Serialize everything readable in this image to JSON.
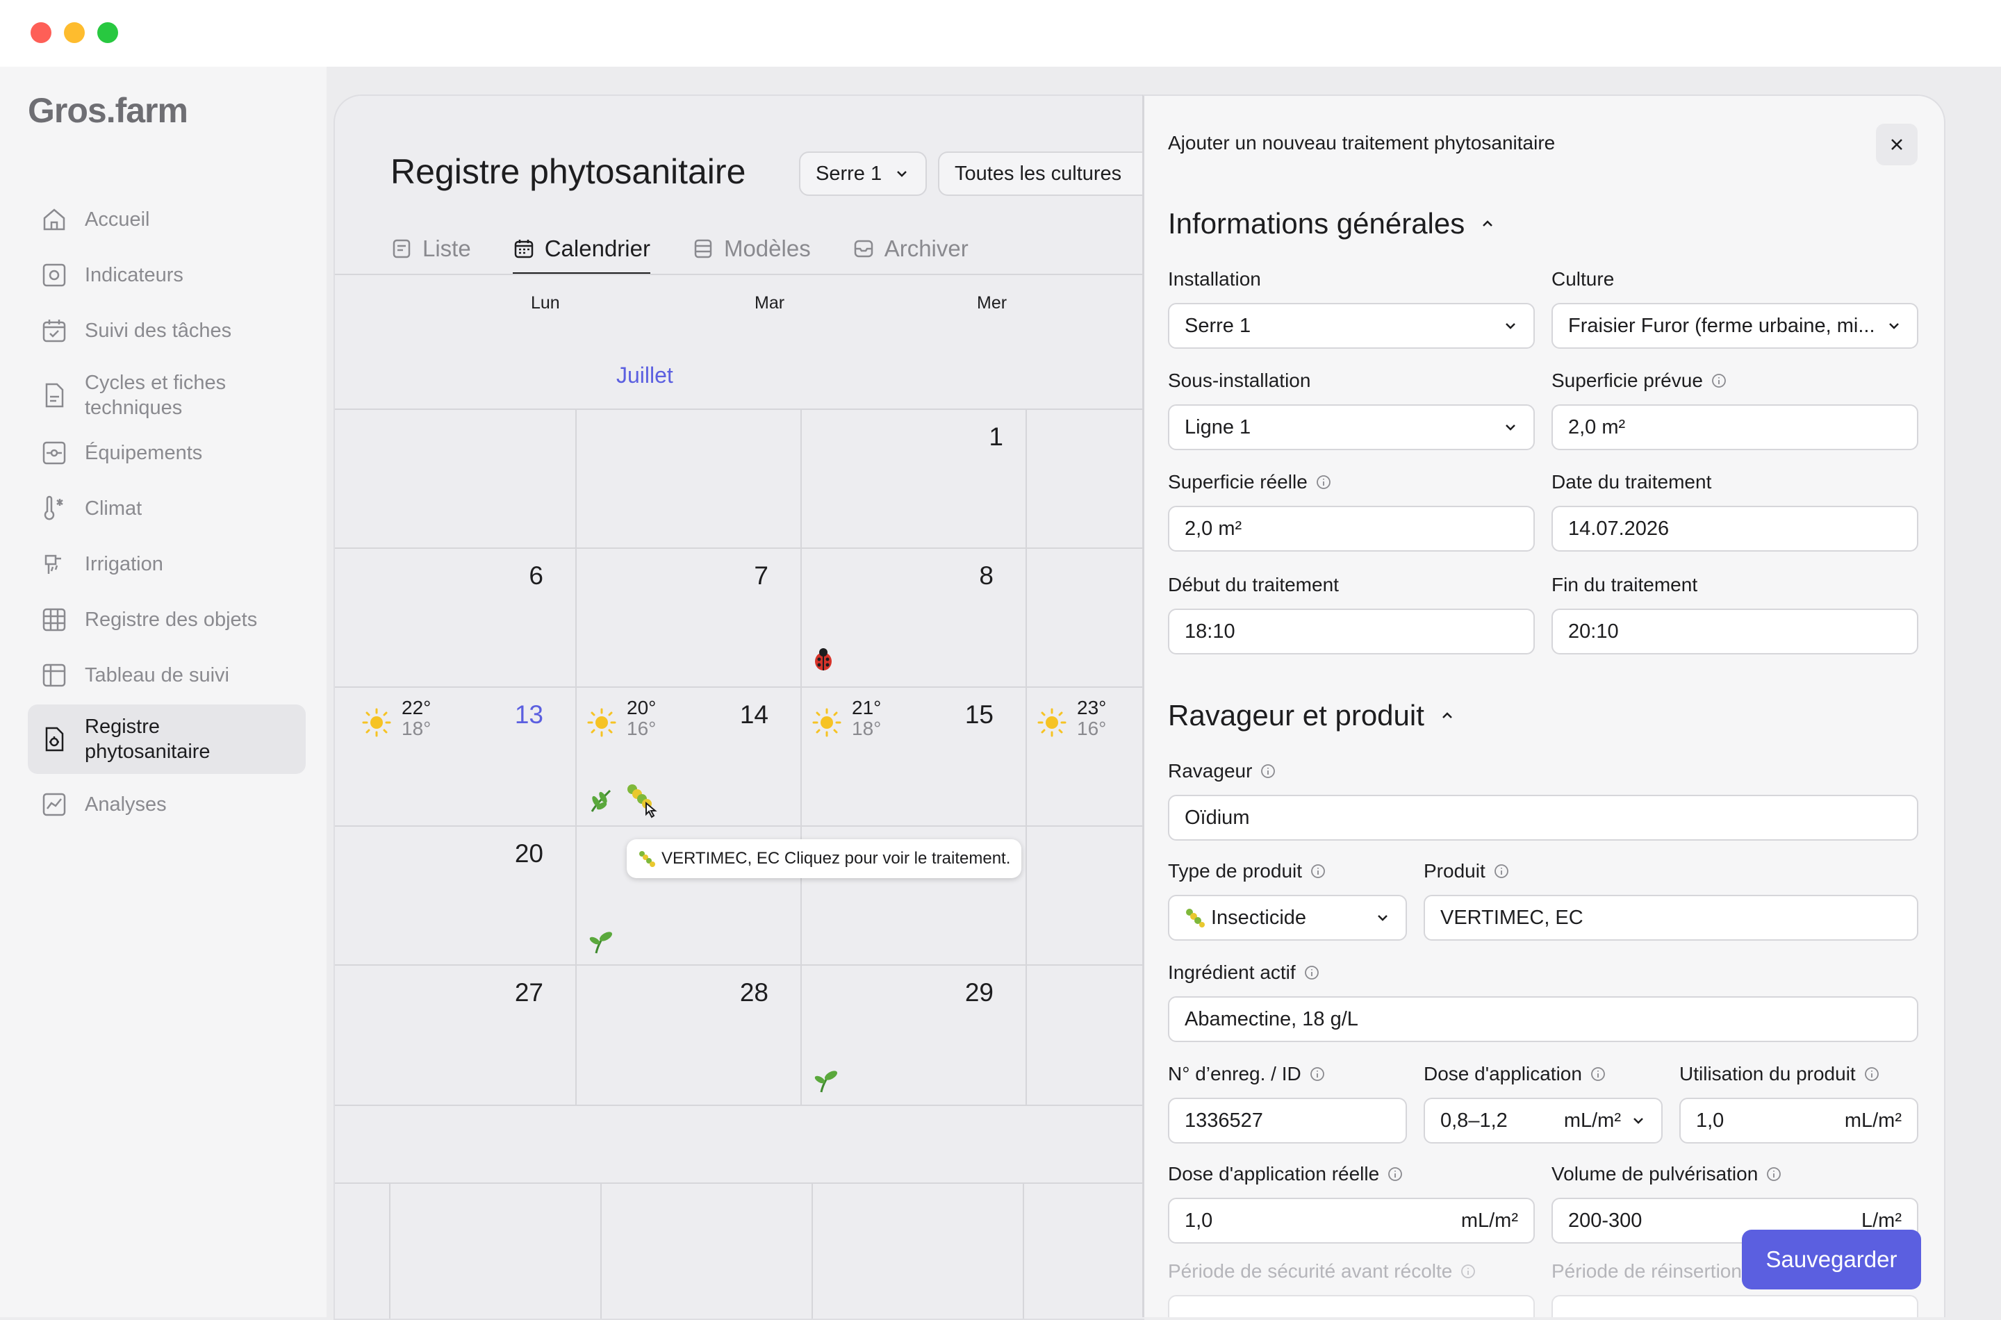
{
  "app": {
    "logo": "Gros.farm"
  },
  "sidebar": {
    "items": [
      {
        "label": "Accueil",
        "icon": "home-icon"
      },
      {
        "label": "Indicateurs",
        "icon": "indicators-icon"
      },
      {
        "label": "Suivi des tâches",
        "icon": "calendar-check-icon"
      },
      {
        "label": "Cycles et fiches techniques",
        "icon": "document-icon"
      },
      {
        "label": "Équipements",
        "icon": "equipment-icon"
      },
      {
        "label": "Climat",
        "icon": "thermometer-icon"
      },
      {
        "label": "Irrigation",
        "icon": "irrigation-icon"
      },
      {
        "label": "Registre des objets",
        "icon": "grid-icon"
      },
      {
        "label": "Tableau de suivi",
        "icon": "table-icon"
      },
      {
        "label": "Registre phytosanitaire",
        "icon": "phyto-register-icon",
        "active": true
      },
      {
        "label": "Analyses",
        "icon": "chart-icon"
      }
    ]
  },
  "main": {
    "title": "Registre phytosanitaire",
    "filters": {
      "installation": "Serre 1",
      "culture": "Toutes les cultures"
    },
    "tabs": [
      {
        "label": "Liste",
        "icon": "list-icon"
      },
      {
        "label": "Calendrier",
        "icon": "calendar-icon",
        "active": true
      },
      {
        "label": "Modèles",
        "icon": "templates-icon"
      },
      {
        "label": "Archiver",
        "icon": "archive-icon"
      }
    ],
    "calendar": {
      "day_headers": [
        "Lun",
        "Mar",
        "Mer"
      ],
      "month": "Juillet",
      "days": {
        "d1": "1",
        "d6": "6",
        "d7": "7",
        "d8": "8",
        "d13": "13",
        "d14": "14",
        "d15": "15",
        "d20": "20",
        "d27": "27",
        "d28": "28",
        "d29": "29"
      },
      "weather": [
        {
          "hi": "22°",
          "lo": "18°"
        },
        {
          "hi": "20°",
          "lo": "16°"
        },
        {
          "hi": "21°",
          "lo": "18°"
        },
        {
          "hi": "23°",
          "lo": "16°"
        }
      ],
      "tooltip": "VERTIMEC, EC Cliquez pour voir le traitement."
    }
  },
  "panel": {
    "title": "Ajouter un nouveau traitement phytosanitaire",
    "sections": {
      "general": "Informations générales",
      "pest": "Ravageur et produit"
    },
    "fields": {
      "installation": {
        "label": "Installation",
        "value": "Serre 1"
      },
      "culture": {
        "label": "Culture",
        "value": "Fraisier Furor (ferme urbaine, mi..."
      },
      "sub_installation": {
        "label": "Sous-installation",
        "value": "Ligne 1"
      },
      "planned_area": {
        "label": "Superficie prévue",
        "value": "2,0 m²"
      },
      "real_area": {
        "label": "Superficie réelle",
        "value": "2,0 m²"
      },
      "treatment_date": {
        "label": "Date du traitement",
        "value": "14.07.2026"
      },
      "start": {
        "label": "Début du traitement",
        "value": "18:10"
      },
      "end": {
        "label": "Fin du traitement",
        "value": "20:10"
      },
      "pest": {
        "label": "Ravageur",
        "value": "Oïdium"
      },
      "product_type": {
        "label": "Type de produit",
        "value": "Insecticide"
      },
      "product": {
        "label": "Produit",
        "value": "VERTIMEC, EC"
      },
      "active_ingredient": {
        "label": "Ingrédient actif",
        "value": "Abamectine, 18 g/L"
      },
      "reg_no": {
        "label": "N° d’enreg. / ID",
        "value": "1336527"
      },
      "dose": {
        "label": "Dose d'application",
        "value": "0,8–1,2",
        "unit": "mL/m²"
      },
      "usage": {
        "label": "Utilisation du produit",
        "value": "1,0",
        "unit": "mL/m²"
      },
      "real_dose": {
        "label": "Dose d'application réelle",
        "value": "1,0",
        "unit": "mL/m²"
      },
      "spray_volume": {
        "label": "Volume de pulvérisation",
        "value": "200-300",
        "unit": "L/m²"
      },
      "safety_period": {
        "label": "Période de sécurité avant récolte"
      },
      "reentry_period": {
        "label": "Période de réinsertion"
      }
    },
    "save_label": "Sauvegarder"
  },
  "colors": {
    "accent": "#5b5fe0",
    "sun": "#f6c324"
  }
}
